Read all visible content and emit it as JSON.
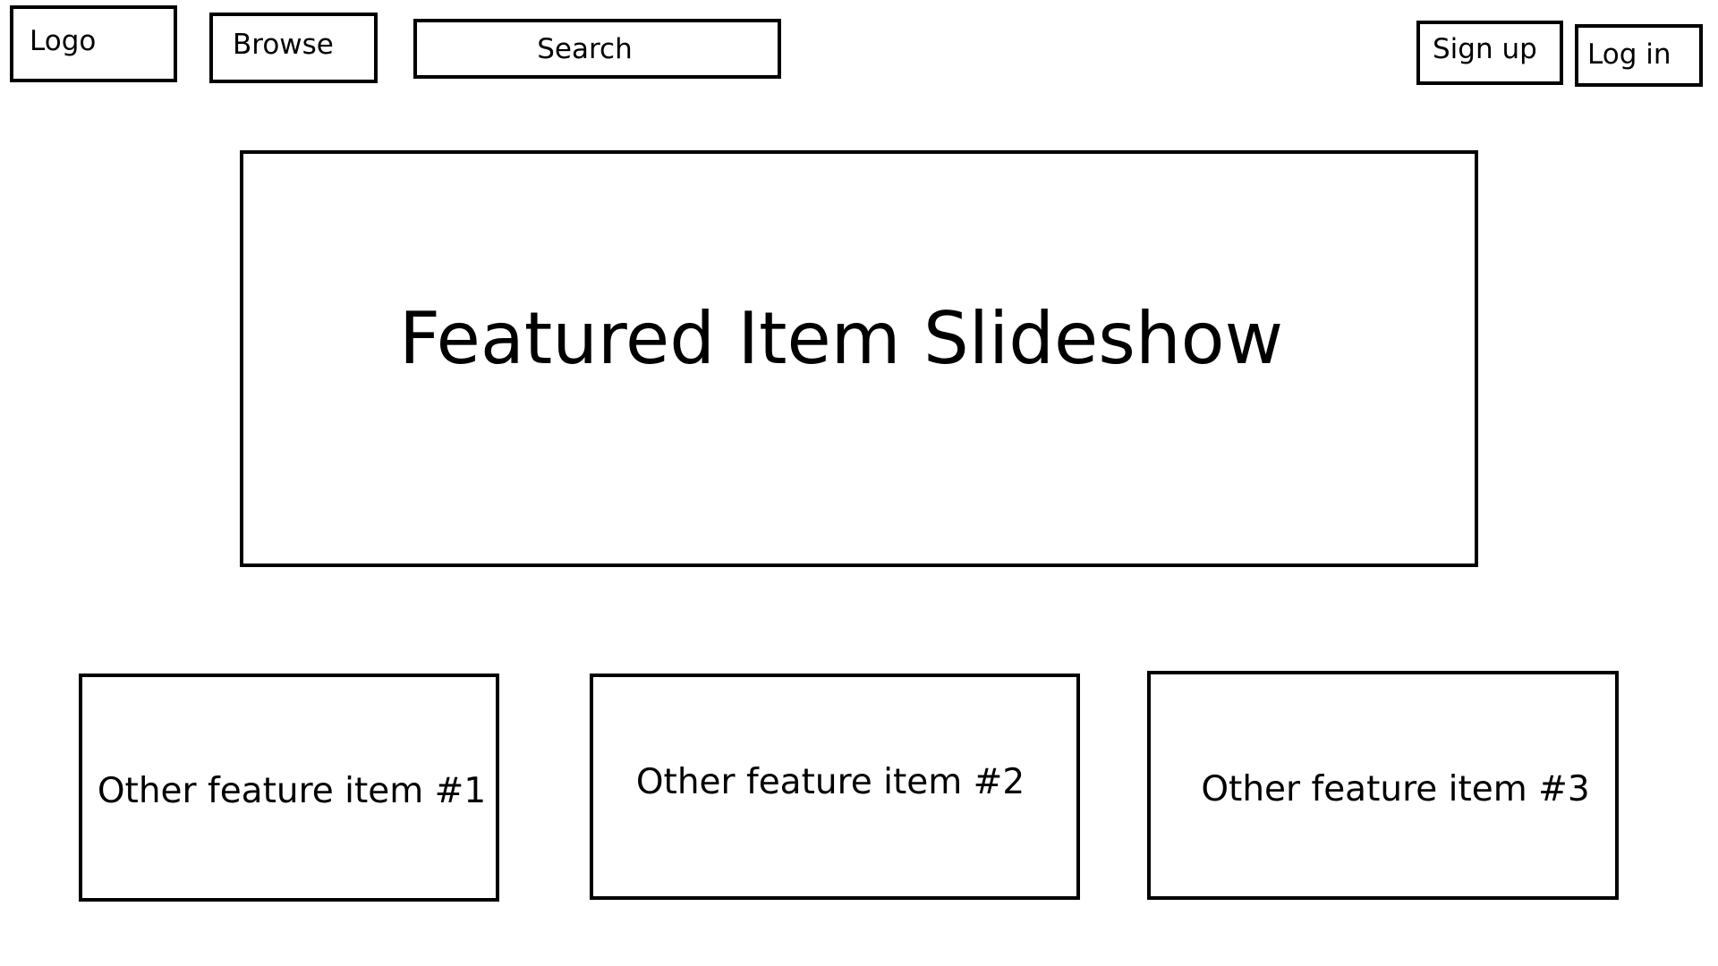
{
  "header": {
    "logo_label": "Logo",
    "browse_label": "Browse",
    "search_label": "Search",
    "signup_label": "Sign up",
    "login_label": "Log in"
  },
  "slideshow": {
    "title": "Featured Item Slideshow"
  },
  "features": [
    {
      "label": "Other feature item #1"
    },
    {
      "label": "Other feature item #2"
    },
    {
      "label": "Other feature item #3"
    }
  ],
  "colors": {
    "border": "#000000",
    "background": "#ffffff",
    "text": "#000000"
  }
}
